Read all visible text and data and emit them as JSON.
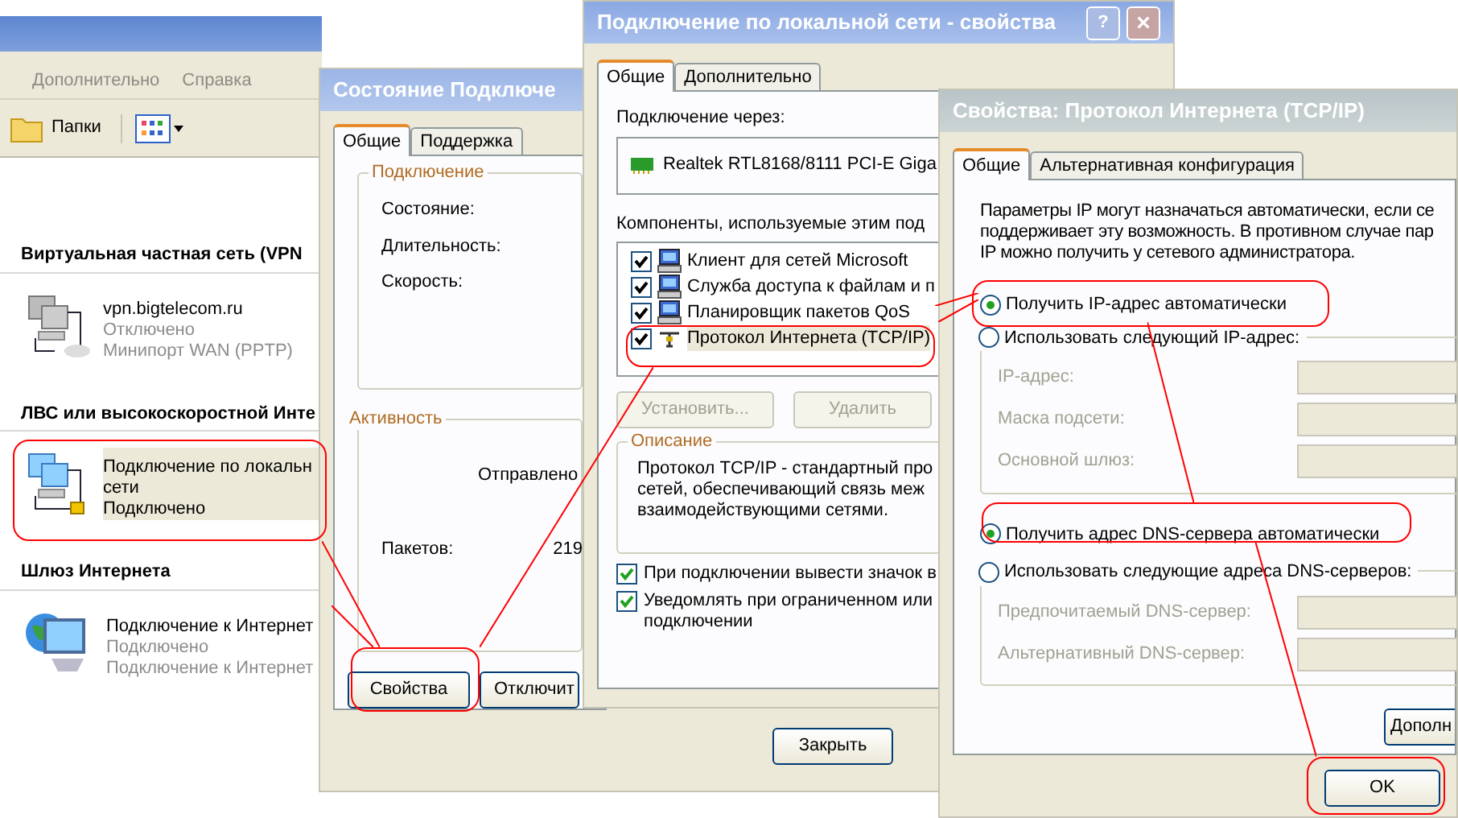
{
  "explorer": {
    "menu": [
      "Дополнительно",
      "Справка"
    ],
    "toolbar": {
      "folders": "Папки"
    },
    "groups": [
      {
        "title": "Виртуальная частная сеть (VPN",
        "items": [
          {
            "kind": "vpn",
            "name_lines": [
              "vpn.bigtelecom.ru"
            ],
            "status": "Отключено",
            "device": "Минипорт WAN (PPTP)",
            "selected": false
          }
        ]
      },
      {
        "title": "ЛВС или высокоскоростной Инте",
        "items": [
          {
            "kind": "lan",
            "name_lines": [
              "Подключение по локальн",
              "сети"
            ],
            "status": "Подключено",
            "selected": true
          }
        ]
      },
      {
        "title": "Шлюз Интернета",
        "items": [
          {
            "kind": "gateway",
            "name_lines": [
              "Подключение к Интернет"
            ],
            "status": "Подключено",
            "device": "Подключение к Интернет",
            "selected": false
          }
        ]
      }
    ]
  },
  "status_dialog": {
    "title": "Состояние Подключе",
    "tabs": [
      {
        "label": "Общие",
        "selected": true
      },
      {
        "label": "Поддержка",
        "selected": false
      }
    ],
    "connection": {
      "title": "Подключение",
      "labels": [
        "Состояние:",
        "Длительность:",
        "Скорость:"
      ]
    },
    "activity": {
      "title": "Активность",
      "sent": "Отправлено",
      "packets_label": "Пакетов:",
      "packets_value": "219"
    },
    "buttons": [
      "Свойства",
      "Отключит"
    ],
    "close_button": "Закрыть"
  },
  "lan_dialog": {
    "title": "Подключение по локальной сети - свойства",
    "help": "?",
    "close": "×",
    "tabs": [
      {
        "label": "Общие",
        "selected": true
      },
      {
        "label": "Дополнительно",
        "selected": false
      }
    ],
    "connect_via_label": "Подключение через:",
    "adapter": "Realtek RTL8168/8111 PCI-E Giga",
    "components_label": "Компоненты, используемые этим под",
    "components": [
      {
        "kind": "client",
        "label": "Клиент для сетей Microsoft",
        "checked": true,
        "selected": false
      },
      {
        "kind": "service",
        "label": "Служба доступа к файлам и п",
        "checked": true,
        "selected": false
      },
      {
        "kind": "service",
        "label": "Планировщик пакетов QoS",
        "checked": true,
        "selected": false
      },
      {
        "kind": "protocol",
        "label": "Протокол Интернета (TCP/IP)",
        "checked": true,
        "selected": true
      }
    ],
    "buttons": [
      {
        "label": "Установить...",
        "disabled": true
      },
      {
        "label": "Удалить",
        "disabled": true
      }
    ],
    "description": {
      "title": "Описание",
      "lines": [
        "Протокол TCP/IP - стандартный про",
        "сетей, обеспечивающий связь меж",
        "взаимодействующими сетями."
      ]
    },
    "options": [
      {
        "lines": [
          "При подключении вывести значок в"
        ],
        "checked": true
      },
      {
        "lines": [
          "Уведомлять при ограниченном или",
          "подключении"
        ],
        "checked": true
      }
    ]
  },
  "tcp_dialog": {
    "title": "Свойства: Протокол Интернета (TCP/IP)",
    "tabs": [
      {
        "label": "Общие",
        "selected": true
      },
      {
        "label": "Альтернативная конфигурация",
        "selected": false
      }
    ],
    "intro_lines": [
      "Параметры IP могут назначаться автоматически, если се",
      "поддерживает эту возможность. В противном случае пар",
      "IP можно получить у сетевого администратора."
    ],
    "ip_modes": [
      {
        "label": "Получить IP-адрес автоматически",
        "selected": true
      },
      {
        "label": "Использовать следующий IP-адрес:",
        "selected": false
      }
    ],
    "ip_fields": [
      {
        "label": "IP-адрес:",
        "disabled": true
      },
      {
        "label": "Маска подсети:",
        "disabled": true
      },
      {
        "label": "Основной шлюз:",
        "disabled": true
      }
    ],
    "dns_modes": [
      {
        "label": "Получить адрес DNS-сервера автоматически",
        "selected": true
      },
      {
        "label": "Использовать следующие адреса DNS-серверов:",
        "selected": false
      }
    ],
    "dns_fields": [
      {
        "label": "Предпочитаемый DNS-сервер:",
        "disabled": true
      },
      {
        "label": "Альтернативный DNS-сервер:",
        "disabled": true
      }
    ],
    "advanced_button": "Дополн",
    "ok_button": "OK"
  }
}
